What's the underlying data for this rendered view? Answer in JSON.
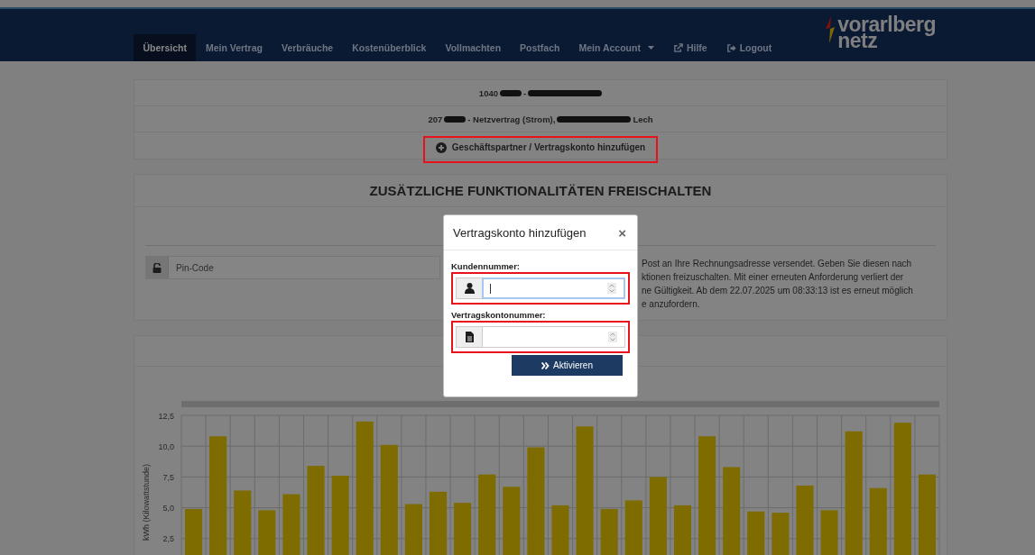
{
  "nav": {
    "items": [
      {
        "label": "Übersicht",
        "kind": "link",
        "selected": true
      },
      {
        "label": "Mein Vertrag",
        "kind": "link",
        "selected": false
      },
      {
        "label": "Verbräuche",
        "kind": "link",
        "selected": false
      },
      {
        "label": "Kostenüberblick",
        "kind": "link",
        "selected": false
      },
      {
        "label": "Vollmachten",
        "kind": "link",
        "selected": false
      },
      {
        "label": "Postfach",
        "kind": "link",
        "selected": false
      },
      {
        "label": "Mein Account",
        "kind": "dropdown",
        "selected": false
      },
      {
        "label": "Hilfe",
        "kind": "external",
        "selected": false
      },
      {
        "label": "Logout",
        "kind": "logout",
        "selected": false
      }
    ]
  },
  "logo": {
    "line_1": "vorarlberg",
    "line_2": "netz"
  },
  "contracts": {
    "rows": [
      {
        "segments": [
          {
            "kind": "text",
            "text": "1040"
          },
          {
            "kind": "redacted"
          },
          {
            "kind": "text",
            "text": "-"
          },
          {
            "kind": "redacted"
          }
        ]
      },
      {
        "segments": [
          {
            "kind": "text",
            "text": "207"
          },
          {
            "kind": "redacted"
          },
          {
            "kind": "text",
            "text": "- Netzvertrag (Strom),"
          },
          {
            "kind": "redacted"
          },
          {
            "kind": "text",
            "text": "Lech"
          }
        ]
      }
    ],
    "add_button": {
      "label": "Geschäftspartner / Vertragskonto hinzufügen",
      "highlighted": true
    }
  },
  "unlock": {
    "title": "ZUSÄTZLICHE FUNKTIONALITÄTEN FREISCHALTEN",
    "pin_field": {
      "placeholder": "Pin-Code"
    },
    "info_lines": [
      "Post an Ihre Rechnungsadresse versendet. Geben Sie diesen nach",
      "ktionen freizuschalten. Mit einer erneuten Anforderung verliert der",
      "ne Gültigkeit. Ab dem 22.07.2025 um 08:33:13 ist es erneut möglich",
      "e anzufordern."
    ]
  },
  "chart_panel": {
    "chart_data": {
      "type": "bar",
      "ylabel": "kWh (Kilowattstunde)",
      "ylim": [
        0,
        12.5
      ],
      "yticks": [
        {
          "value": 2.5,
          "label": "2,5"
        },
        {
          "value": 5,
          "label": "5,0"
        },
        {
          "value": 7.5,
          "label": "7,5"
        },
        {
          "value": 10,
          "label": "10,0"
        },
        {
          "value": 12.5,
          "label": "12,5"
        }
      ],
      "grid": true,
      "series": [
        {
          "color": "#7f6c00",
          "values": [
            4.9,
            10.8,
            6.4,
            4.8,
            6.1,
            8.4,
            7.6,
            12.0,
            10.1,
            5.3,
            6.3,
            5.4,
            7.7,
            6.7,
            9.9,
            5.2,
            11.6,
            4.9,
            5.6,
            7.5,
            5.2,
            10.8,
            8.3,
            4.7,
            4.6,
            6.8,
            4.8,
            11.2,
            6.6,
            11.9,
            7.7
          ]
        }
      ]
    }
  },
  "modal": {
    "title": "Vertragskonto hinzufügen",
    "close": "×",
    "fields": [
      {
        "label": "Kundennummer:",
        "kind": "person",
        "focused": true,
        "highlighted": true
      },
      {
        "label": "Vertragskontonummer:",
        "kind": "document",
        "focused": false,
        "highlighted": true
      }
    ],
    "submit": {
      "label": "Aktivieren"
    }
  }
}
